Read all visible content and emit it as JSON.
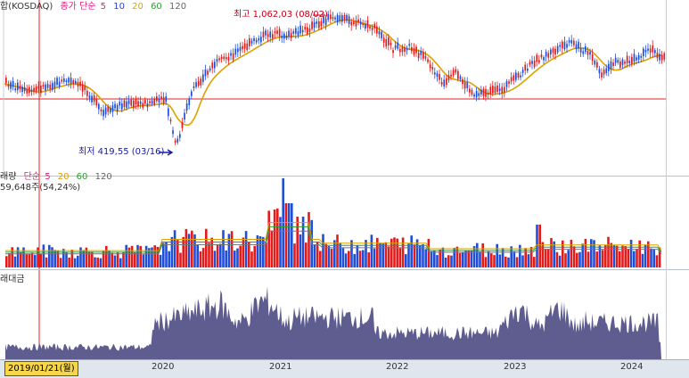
{
  "price_panel": {
    "index_name": "합(KOSDAQ)",
    "ma_title": "종가 단순",
    "ma_periods": [
      "5",
      "10",
      "20",
      "60",
      "120"
    ],
    "ma_colors": [
      "#e0207f",
      "#2a43d0",
      "#e0a000",
      "#2ca02c",
      "#666666"
    ],
    "high_label": "최고 1,062,03 (08/02)",
    "low_label": "최저 419,55 (03/16)"
  },
  "volume_panel": {
    "title": "래량",
    "ma_title": "단순",
    "ma_periods": [
      "5",
      "20",
      "60",
      "120"
    ],
    "ma_colors": [
      "#e0207f",
      "#e0a000",
      "#2ca02c",
      "#666666"
    ],
    "readout": "59,648주(54,24%)"
  },
  "amount_panel": {
    "title": "래대금"
  },
  "time_axis": {
    "cursor_date": "2019/01/21(월)",
    "years": [
      "2020",
      "2021",
      "2022",
      "2023",
      "2024"
    ]
  },
  "colors": {
    "up": "#e31b1b",
    "down": "#1f4fd8",
    "amount_bar": "#5f5c8f",
    "crosshair": "#e02020",
    "annotation_high": "#c0001a",
    "annotation_low": "#1a1aa0"
  }
}
